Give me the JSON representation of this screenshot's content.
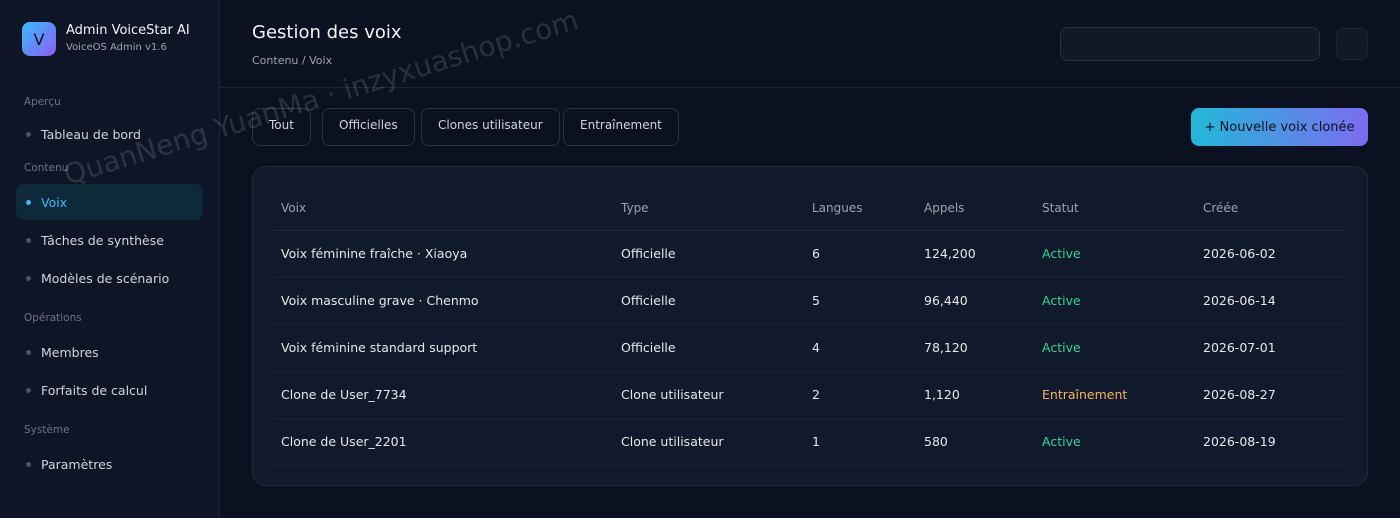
{
  "brand": {
    "logo_letter": "V",
    "title": "Admin VoiceStar AI",
    "subtitle": "VoiceOS Admin v1.6"
  },
  "sidebar": {
    "sections": [
      {
        "label": "Aperçu",
        "items": [
          {
            "label": "Tableau de bord",
            "active": false
          }
        ]
      },
      {
        "label": "Contenu",
        "items": [
          {
            "label": "Voix",
            "active": true
          },
          {
            "label": "Tâches de synthèse",
            "active": false
          },
          {
            "label": "Modèles de scénario",
            "active": false
          }
        ]
      },
      {
        "label": "Opérations",
        "items": [
          {
            "label": "Membres",
            "active": false
          },
          {
            "label": "Forfaits de calcul",
            "active": false
          }
        ]
      },
      {
        "label": "Système",
        "items": [
          {
            "label": "Paramètres",
            "active": false
          }
        ]
      }
    ]
  },
  "header": {
    "title": "Gestion des voix",
    "breadcrumb": "Contenu / Voix"
  },
  "filters": [
    "Tout",
    "Officielles",
    "Clones utilisateur",
    "Entraînement"
  ],
  "actions": {
    "new_voice": "+ Nouvelle voix clonée"
  },
  "table": {
    "columns": [
      "Voix",
      "Type",
      "Langues",
      "Appels",
      "Statut",
      "Créée"
    ],
    "rows": [
      [
        "Voix féminine fraîche · Xiaoya",
        "Officielle",
        "6",
        "124,200",
        "Active",
        "2026-06-02"
      ],
      [
        "Voix masculine grave · Chenmo",
        "Officielle",
        "5",
        "96,440",
        "Active",
        "2026-06-14"
      ],
      [
        "Voix féminine standard support",
        "Officielle",
        "4",
        "78,120",
        "Active",
        "2026-07-01"
      ],
      [
        "Clone de User_7734",
        "Clone utilisateur",
        "2",
        "1,120",
        "Entraînement",
        "2026-08-27"
      ],
      [
        "Clone de User_2201",
        "Clone utilisateur",
        "1",
        "580",
        "Active",
        "2026-08-19"
      ]
    ]
  },
  "colors": {
    "accent": "#38bdf8",
    "status_active": "#34d399",
    "status_training": "#f5b366"
  },
  "watermark": "QuanNeng YuanMa · inzyxuashop.com"
}
